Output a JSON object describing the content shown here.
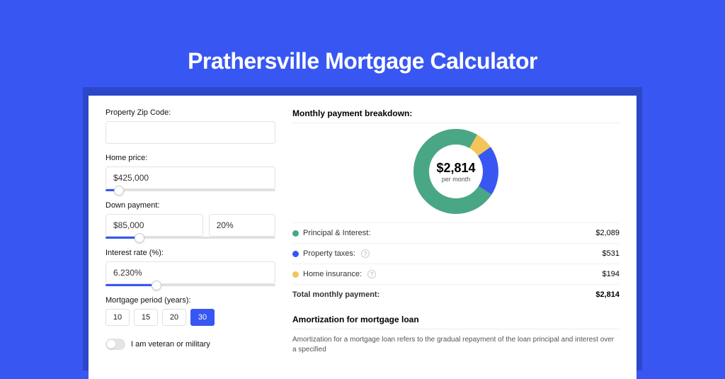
{
  "title": "Prathersville Mortgage Calculator",
  "form": {
    "zip_label": "Property Zip Code:",
    "zip_value": "",
    "price_label": "Home price:",
    "price_value": "$425,000",
    "down_label": "Down payment:",
    "down_value": "$85,000",
    "down_pct": "20%",
    "rate_label": "Interest rate (%):",
    "rate_value": "6.230%",
    "period_label": "Mortgage period (years):",
    "periods": [
      "10",
      "15",
      "20",
      "30"
    ],
    "period_active": "30",
    "veteran_label": "I am veteran or military",
    "sliders": {
      "price_pct": 8,
      "down_pct": 20,
      "rate_pct": 30
    }
  },
  "breakdown": {
    "title": "Monthly payment breakdown:",
    "amount": "$2,814",
    "sub": "per month",
    "items": [
      {
        "label": "Principal & Interest:",
        "value_str": "$2,089",
        "value": 2089,
        "color": "#4aa785",
        "help": false
      },
      {
        "label": "Property taxes:",
        "value_str": "$531",
        "value": 531,
        "color": "#3857f2",
        "help": true
      },
      {
        "label": "Home insurance:",
        "value_str": "$194",
        "value": 194,
        "color": "#f2c55a",
        "help": true
      }
    ],
    "total_label": "Total monthly payment:",
    "total_value": "$2,814"
  },
  "amort": {
    "title": "Amortization for mortgage loan",
    "text": "Amortization for a mortgage loan refers to the gradual repayment of the loan principal and interest over a specified"
  },
  "chart_data": {
    "type": "pie",
    "title": "Monthly payment breakdown",
    "categories": [
      "Principal & Interest",
      "Property taxes",
      "Home insurance"
    ],
    "values": [
      2089,
      531,
      194
    ],
    "colors": [
      "#4aa785",
      "#3857f2",
      "#f2c55a"
    ],
    "total": 2814,
    "center_label": "$2,814 per month"
  }
}
